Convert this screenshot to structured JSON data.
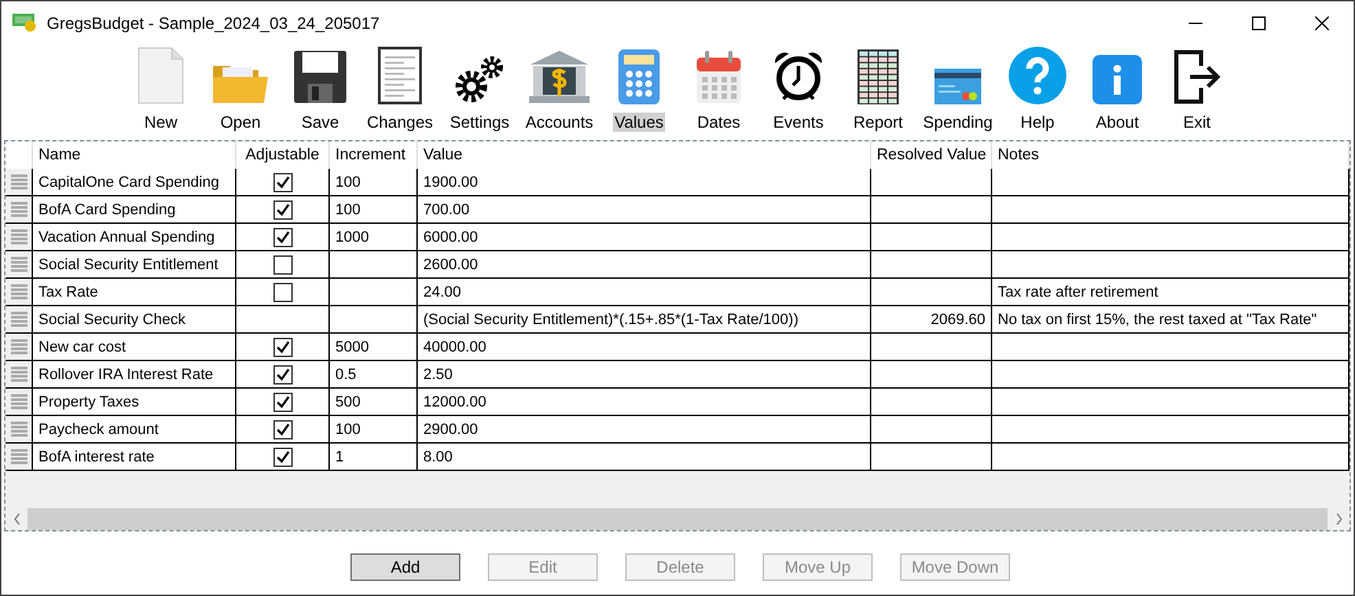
{
  "window": {
    "title": "GregsBudget - Sample_2024_03_24_205017"
  },
  "toolbar": [
    {
      "label": "New",
      "selected": false
    },
    {
      "label": "Open",
      "selected": false
    },
    {
      "label": "Save",
      "selected": false
    },
    {
      "label": "Changes",
      "selected": false
    },
    {
      "label": "Settings",
      "selected": false
    },
    {
      "label": "Accounts",
      "selected": false
    },
    {
      "label": "Values",
      "selected": true
    },
    {
      "label": "Dates",
      "selected": false
    },
    {
      "label": "Events",
      "selected": false
    },
    {
      "label": "Report",
      "selected": false
    },
    {
      "label": "Spending",
      "selected": false
    },
    {
      "label": "Help",
      "selected": false
    },
    {
      "label": "About",
      "selected": false
    },
    {
      "label": "Exit",
      "selected": false
    }
  ],
  "table": {
    "columns": [
      "Name",
      "Adjustable",
      "Increment",
      "Value",
      "Resolved Value",
      "Notes"
    ],
    "rows": [
      {
        "name": "CapitalOne Card Spending",
        "kind": "checkbox",
        "checked": true,
        "increment": "100",
        "value": "1900.00"
      },
      {
        "name": "BofA Card Spending",
        "kind": "checkbox",
        "checked": true,
        "increment": "100",
        "value": "700.00"
      },
      {
        "name": "Vacation Annual Spending",
        "kind": "checkbox",
        "checked": true,
        "increment": "1000",
        "value": "6000.00"
      },
      {
        "name": "Social Security Entitlement",
        "kind": "checkbox",
        "checked": false,
        "value": "2600.00"
      },
      {
        "name": "Tax Rate",
        "kind": "checkbox",
        "checked": false,
        "value": "24.00",
        "notes": "Tax rate after retirement"
      },
      {
        "name": "Social Security Check",
        "kind": "formula",
        "value": "(Social Security Entitlement)*(.15+.85*(1-Tax Rate/100))",
        "resolved": "2069.60",
        "notes": "No tax on first 15%, the rest taxed at \"Tax Rate\""
      },
      {
        "name": "New car cost",
        "kind": "checkbox",
        "checked": true,
        "increment": "5000",
        "value": "40000.00"
      },
      {
        "name": "Rollover IRA Interest Rate",
        "kind": "checkbox",
        "checked": true,
        "increment": "0.5",
        "value": "2.50"
      },
      {
        "name": "Property Taxes",
        "kind": "checkbox",
        "checked": true,
        "increment": "500",
        "value": "12000.00"
      },
      {
        "name": "Paycheck amount",
        "kind": "checkbox",
        "checked": true,
        "increment": "100",
        "value": "2900.00"
      },
      {
        "name": "BofA interest rate",
        "kind": "checkbox",
        "checked": true,
        "increment": "1",
        "value": "8.00"
      }
    ]
  },
  "buttons": [
    {
      "label": "Add",
      "disabled": false
    },
    {
      "label": "Edit",
      "disabled": true
    },
    {
      "label": "Delete",
      "disabled": true
    },
    {
      "label": "Move Up",
      "disabled": true
    },
    {
      "label": "Move Down",
      "disabled": true
    }
  ]
}
